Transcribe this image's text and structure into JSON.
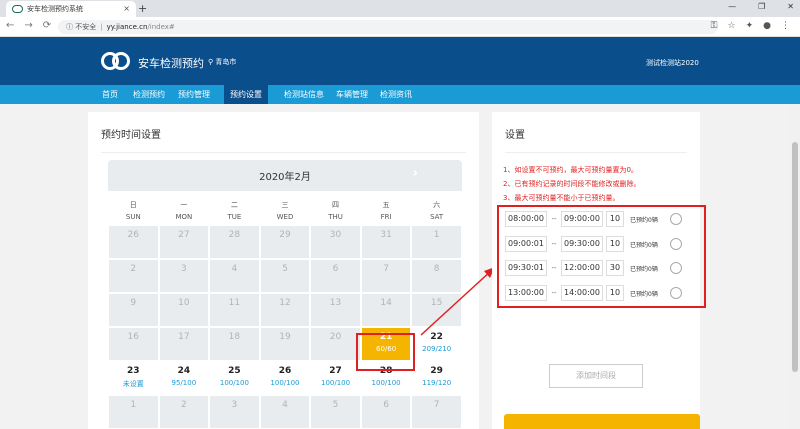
{
  "browser": {
    "tab_title": "安车检测预约系统",
    "tab_close": "×",
    "new_tab": "+",
    "window_controls": [
      "—",
      "❐",
      "✕"
    ],
    "nav": {
      "back": "←",
      "forward": "→",
      "reload": "⟳"
    },
    "security_label": "ⓘ 不安全",
    "host": "yy.jiance.cn",
    "path": "/index#",
    "addr_icons": [
      "key-icon",
      "star-icon",
      "puzzle-icon",
      "account-icon",
      "more-icon"
    ]
  },
  "header": {
    "brand": "安车检测预约",
    "city": "青岛市",
    "station": "测试检测站2020"
  },
  "nav": {
    "items": [
      "首页",
      "检测预约",
      "预约管理",
      "预约设置",
      "检测站信息",
      "车辆管理",
      "检测资讯"
    ],
    "active_index": 3
  },
  "left": {
    "title": "预约时间设置",
    "calendar": {
      "month": "2020年2月",
      "next_arrow": "›",
      "weekdays": [
        {
          "cn": "日",
          "en": "SUN"
        },
        {
          "cn": "一",
          "en": "MON"
        },
        {
          "cn": "二",
          "en": "TUE"
        },
        {
          "cn": "三",
          "en": "WED"
        },
        {
          "cn": "四",
          "en": "THU"
        },
        {
          "cn": "五",
          "en": "FRI"
        },
        {
          "cn": "六",
          "en": "SAT"
        }
      ],
      "rows": [
        [
          {
            "d": "26"
          },
          {
            "d": "27"
          },
          {
            "d": "28"
          },
          {
            "d": "29"
          },
          {
            "d": "30"
          },
          {
            "d": "31"
          },
          {
            "d": "1"
          }
        ],
        [
          {
            "d": "2"
          },
          {
            "d": "3"
          },
          {
            "d": "4"
          },
          {
            "d": "5"
          },
          {
            "d": "6"
          },
          {
            "d": "7"
          },
          {
            "d": "8"
          }
        ],
        [
          {
            "d": "9"
          },
          {
            "d": "10"
          },
          {
            "d": "11"
          },
          {
            "d": "12"
          },
          {
            "d": "13"
          },
          {
            "d": "14"
          },
          {
            "d": "15"
          }
        ],
        [
          {
            "d": "16"
          },
          {
            "d": "17"
          },
          {
            "d": "18"
          },
          {
            "d": "19"
          },
          {
            "d": "20"
          },
          {
            "d": "21",
            "sub": "60/60",
            "state": "selected"
          },
          {
            "d": "22",
            "sub": "209/210",
            "state": "active"
          }
        ],
        [
          {
            "d": "23",
            "sub": "未设置",
            "state": "active"
          },
          {
            "d": "24",
            "sub": "95/100",
            "state": "active"
          },
          {
            "d": "25",
            "sub": "100/100",
            "state": "active"
          },
          {
            "d": "26",
            "sub": "100/100",
            "state": "active"
          },
          {
            "d": "27",
            "sub": "100/100",
            "state": "active"
          },
          {
            "d": "28",
            "sub": "100/100",
            "state": "active"
          },
          {
            "d": "29",
            "sub": "119/120",
            "state": "active"
          }
        ],
        [
          {
            "d": "1"
          },
          {
            "d": "2"
          },
          {
            "d": "3"
          },
          {
            "d": "4"
          },
          {
            "d": "5"
          },
          {
            "d": "6"
          },
          {
            "d": "7"
          }
        ]
      ]
    }
  },
  "right": {
    "title": "设置",
    "rules": [
      "1、如设置不可预约，最大可预约量置为0。",
      "2、已有预约记录的时间段不能修改或删除。",
      "3、最大可预约量不能小于已预约量。"
    ],
    "slots": [
      {
        "start": "08:00:00",
        "end": "09:00:00",
        "count": "10",
        "label": "已预约0辆"
      },
      {
        "start": "09:00:01",
        "end": "09:30:00",
        "count": "10",
        "label": "已预约0辆"
      },
      {
        "start": "09:30:01",
        "end": "12:00:00",
        "count": "30",
        "label": "已预约0辆"
      },
      {
        "start": "13:00:00",
        "end": "14:00:00",
        "count": "10",
        "label": "已预约0辆"
      }
    ],
    "slot_separator": "--",
    "add_button": "添加时间段"
  },
  "colors": {
    "header_bg": "#0b4e8c",
    "nav_bg": "#1b9bd6",
    "accent": "#f4b400",
    "highlight": "#e02020"
  }
}
